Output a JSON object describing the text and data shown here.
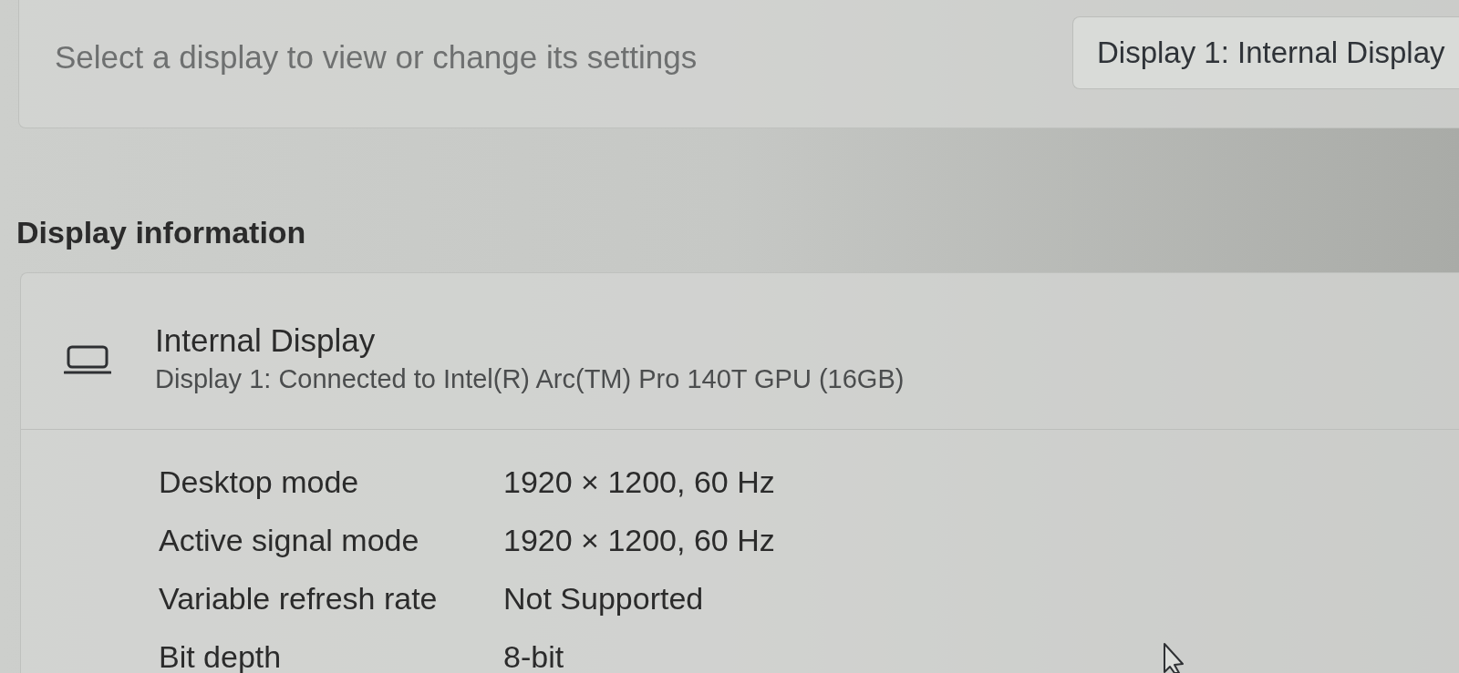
{
  "display_selector": {
    "label": "Select a display to view or change its settings",
    "selected_display": "Display 1: Internal Display"
  },
  "display_information": {
    "heading": "Display information",
    "display": {
      "name": "Internal Display",
      "description": "Display 1: Connected to Intel(R) Arc(TM) Pro 140T GPU (16GB)"
    },
    "properties": [
      {
        "label": "Desktop mode",
        "value": "1920 × 1200, 60 Hz"
      },
      {
        "label": "Active signal mode",
        "value": "1920 × 1200, 60 Hz"
      },
      {
        "label": "Variable refresh rate",
        "value": "Not Supported"
      },
      {
        "label": "Bit depth",
        "value": "8-bit"
      }
    ]
  }
}
